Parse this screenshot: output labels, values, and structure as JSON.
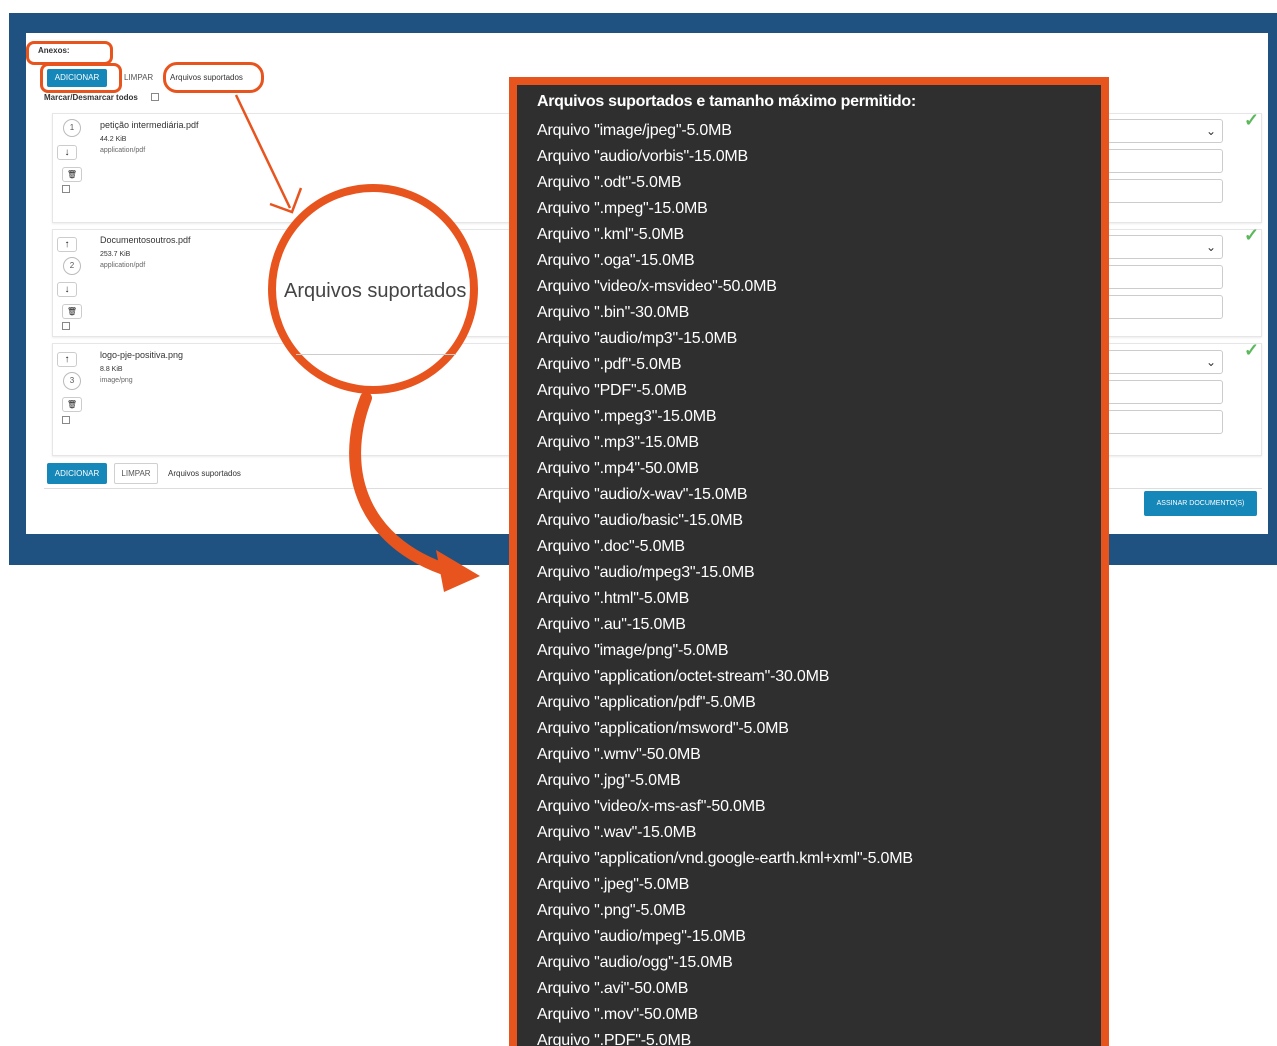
{
  "attachments": {
    "label": "Anexos:",
    "add_label": "ADICIONAR",
    "clear_label": "LIMPAR",
    "supported_label": "Arquivos suportados",
    "toggle_all_label": "Marcar/Desmarcar todos",
    "sign_label": "ASSINAR DOCUMENTO(S)",
    "files": [
      {
        "order": "1",
        "name": "petição intermediária.pdf",
        "size": "44.2 KiB",
        "type": "application/pdf"
      },
      {
        "order": "2",
        "name": "Documentosoutros.pdf",
        "size": "253.7 KiB",
        "type": "application/pdf"
      },
      {
        "order": "3",
        "name": "logo-pje-positiva.png",
        "size": "8.8 KiB",
        "type": "image/png"
      }
    ]
  },
  "zoom": {
    "text": "Arquivos suportados"
  },
  "tooltip": {
    "title": "Arquivos suportados e tamanho máximo permitido:",
    "items": [
      "Arquivo \"image/jpeg\"-5.0MB",
      "Arquivo \"audio/vorbis\"-15.0MB",
      "Arquivo \".odt\"-5.0MB",
      "Arquivo \".mpeg\"-15.0MB",
      "Arquivo \".kml\"-5.0MB",
      "Arquivo \".oga\"-15.0MB",
      "Arquivo \"video/x-msvideo\"-50.0MB",
      "Arquivo \".bin\"-30.0MB",
      "Arquivo \"audio/mp3\"-15.0MB",
      "Arquivo \".pdf\"-5.0MB",
      "Arquivo \"PDF\"-5.0MB",
      "Arquivo \".mpeg3\"-15.0MB",
      "Arquivo \".mp3\"-15.0MB",
      "Arquivo \".mp4\"-50.0MB",
      "Arquivo \"audio/x-wav\"-15.0MB",
      "Arquivo \"audio/basic\"-15.0MB",
      "Arquivo \".doc\"-5.0MB",
      "Arquivo \"audio/mpeg3\"-15.0MB",
      "Arquivo \".html\"-5.0MB",
      "Arquivo \".au\"-15.0MB",
      "Arquivo \"image/png\"-5.0MB",
      "Arquivo \"application/octet-stream\"-30.0MB",
      "Arquivo \"application/pdf\"-5.0MB",
      "Arquivo \"application/msword\"-5.0MB",
      "Arquivo \".wmv\"-50.0MB",
      "Arquivo \".jpg\"-5.0MB",
      "Arquivo \"video/x-ms-asf\"-50.0MB",
      "Arquivo \".wav\"-15.0MB",
      "Arquivo \"application/vnd.google-earth.kml+xml\"-5.0MB",
      "Arquivo \".jpeg\"-5.0MB",
      "Arquivo \".png\"-5.0MB",
      "Arquivo \"audio/mpeg\"-15.0MB",
      "Arquivo \"audio/ogg\"-15.0MB",
      "Arquivo \".avi\"-50.0MB",
      "Arquivo \".mov\"-50.0MB",
      "Arquivo \".PDF\"-5.0MB"
    ]
  },
  "icons": {
    "arrow_up": "↑",
    "arrow_down": "↓",
    "trash": "🗑",
    "check": "✓",
    "chevron": "⌄"
  },
  "colors": {
    "frame_blue": "#1f5280",
    "button_blue": "#1587b8",
    "highlight_orange": "#e8541e",
    "tooltip_bg": "#2f2f2f",
    "check_green": "#5cb85c"
  }
}
